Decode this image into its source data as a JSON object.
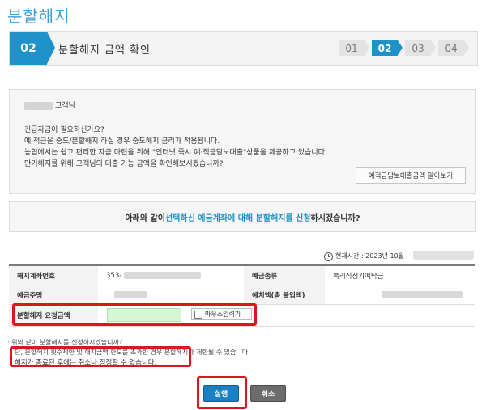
{
  "page": {
    "title": "분할해지"
  },
  "stepbar": {
    "current_number": "02",
    "current_title": "분할해지 금액 확인",
    "steps": [
      "01",
      "02",
      "03",
      "04"
    ],
    "active_index": 1
  },
  "info": {
    "customer_suffix": "고객님",
    "lines": [
      "긴급자금이 필요하신가요?",
      "예·적금을 중도/분할해지 하실 경우 중도해지 금리가 적용됩니다.",
      "농협에서는 쉽고 편리한 자금 마련을 위해 \"인터넷 즉시 예·적금담보대출\"상품을 제공하고 있습니다.",
      "만기해지를 위해 고객님의 대출 가능 금액을 확인해보시겠습니까?"
    ],
    "loan_button": "예적금담보대출금액 알아보기"
  },
  "confirm": {
    "prefix": "아래와 같이 ",
    "highlight1": "선택하신 예금계좌에 대해 분할해지를 신청",
    "suffix": "하시겠습니까?"
  },
  "time": {
    "label": "현재시간 : 2023년 10월"
  },
  "table": {
    "account_label": "해지계좌번호",
    "account_value": "353-",
    "type_label": "예금종류",
    "type_value": "복리식정기예탁금",
    "product_label": "예금주명",
    "balance_label": "예치액(총 불입액)",
    "amount_label": "분할해지 요청금액",
    "amount_value": "",
    "mouse_input": "마우스입력기"
  },
  "notes": {
    "line1": "· 위와 같이 분할해지를 신청하시겠습니까?",
    "line2": "단, 분할해지 횟수제한 및 해지금액 한도를 초과한 경우 분할해지가 제한될 수 있습니다.",
    "line3": "해지가 종료된 후에는 취소나 정정할 수 없습니다."
  },
  "buttons": {
    "execute": "실행",
    "cancel": "취소"
  }
}
